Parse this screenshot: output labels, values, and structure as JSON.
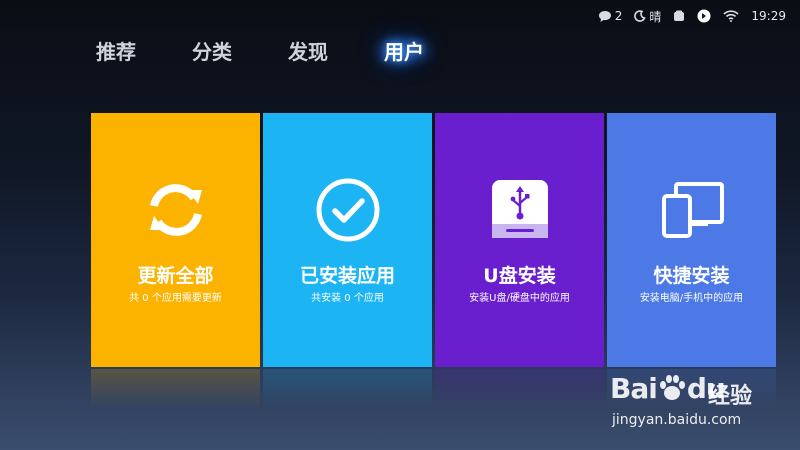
{
  "status_bar": {
    "messages_count": "2",
    "weather": "晴",
    "time": "19:29"
  },
  "tabs": [
    {
      "label": "推荐",
      "active": false
    },
    {
      "label": "分类",
      "active": false
    },
    {
      "label": "发现",
      "active": false
    },
    {
      "label": "用户",
      "active": true
    }
  ],
  "tiles": [
    {
      "title": "更新全部",
      "subtitle": "共 0 个应用需要更新",
      "color": "#fcb300",
      "icon": "refresh-icon"
    },
    {
      "title": "已安装应用",
      "subtitle": "共安装 0 个应用",
      "color": "#1cb4f2",
      "icon": "check-circle-icon"
    },
    {
      "title": "U盘安装",
      "subtitle": "安装U盘/硬盘中的应用",
      "color": "#6a1fcf",
      "icon": "usb-drive-icon"
    },
    {
      "title": "快捷安装",
      "subtitle": "安装电脑/手机中的应用",
      "color": "#4c79e6",
      "icon": "devices-icon"
    }
  ],
  "watermark": {
    "brand_prefix": "Bai",
    "brand_du": "du",
    "brand_suffix": "经验",
    "url": "jingyan.baidu.com"
  }
}
